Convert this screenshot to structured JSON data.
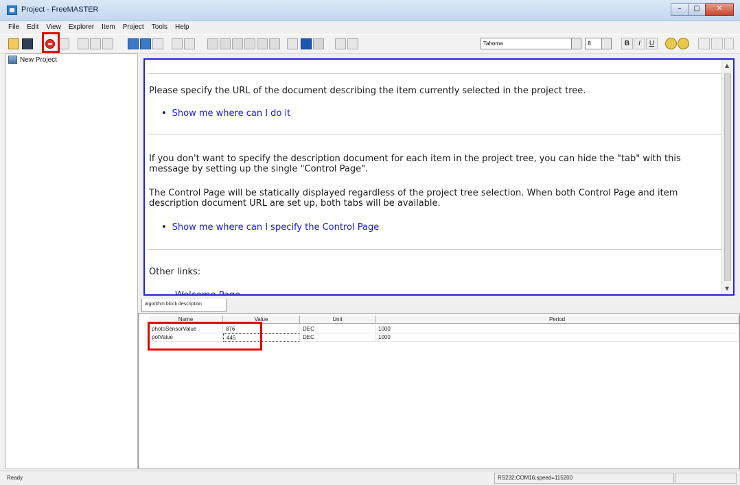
{
  "window": {
    "title": "Project - FreeMASTER"
  },
  "menu": [
    "File",
    "Edit",
    "View",
    "Explorer",
    "Item",
    "Project",
    "Tools",
    "Help"
  ],
  "toolbar": {
    "font_name": "Tahoma",
    "font_size": "8",
    "bold": "B",
    "italic": "I",
    "underline": "U"
  },
  "tree": {
    "root_label": "New Project"
  },
  "description": {
    "p1": "Please specify the URL of the document describing the item currently selected in the project tree.",
    "link1": "Show me where can I do it",
    "p2": "If you don't want to specify the description document for each item in the project tree, you can hide the \"tab\" with this message by setting up the single \"Control Page\".",
    "p3": "The Control Page will be statically displayed regardless of the project tree selection. When both Control Page and item description document URL are set up, both tabs will be available.",
    "link2": "Show me where can I specify the Control Page",
    "other_links": "Other links:",
    "partial_link": "Welcome Page"
  },
  "tab": {
    "label": "algorithm block description"
  },
  "grid": {
    "headers": [
      "Name",
      "Value",
      "Unit",
      "Period"
    ],
    "rows": [
      {
        "name": "photoSensorValue",
        "value": "876",
        "unit": "DEC",
        "period": "1000"
      },
      {
        "name": "potValue",
        "value": "445",
        "unit": "DEC",
        "period": "1000"
      }
    ]
  },
  "status": {
    "left": "Ready",
    "connection": "RS232;COM16;speed=115200"
  },
  "colors": {
    "highlight": "#e40000",
    "frame": "#2321d9",
    "link": "#1b1bd6"
  }
}
